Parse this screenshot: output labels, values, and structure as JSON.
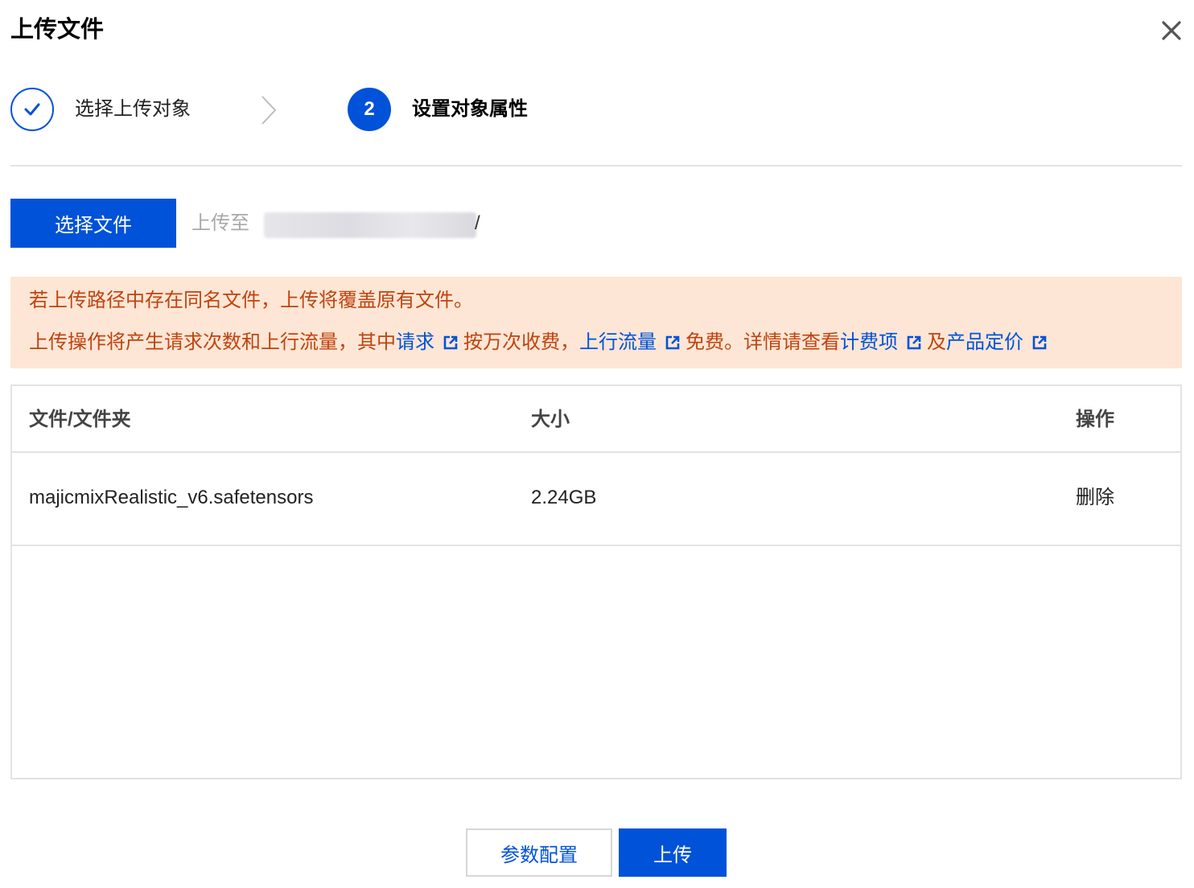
{
  "dialog": {
    "title": "上传文件",
    "close_icon": "close-icon"
  },
  "steps": [
    {
      "label": "选择上传对象",
      "status": "done",
      "icon": "check-icon"
    },
    {
      "number": "2",
      "label": "设置对象属性",
      "status": "active"
    }
  ],
  "toolbar": {
    "select_button": "选择文件",
    "upload_to_label": "上传至",
    "path_suffix": "/"
  },
  "notice": {
    "line1": "若上传路径中存在同名文件，上传将覆盖原有文件。",
    "line2": {
      "p1": "上传操作将产生请求次数和上行流量，其中",
      "link_request": "请求",
      "p2": "按万次收费，",
      "link_traffic": "上行流量",
      "p3": "免费。详情请查看",
      "link_billing": "计费项",
      "p4": "及",
      "link_pricing": "产品定价"
    }
  },
  "table": {
    "headers": {
      "name": "文件/文件夹",
      "size": "大小",
      "operation": "操作"
    },
    "rows": [
      {
        "name": "majicmixRealistic_v6.safetensors",
        "size": "2.24GB",
        "action": "删除"
      }
    ]
  },
  "footer": {
    "params_button": "参数配置",
    "upload_button": "上传"
  },
  "colors": {
    "primary": "#0052d9",
    "notice_bg": "#fde6d5",
    "notice_text": "#c0430f",
    "border": "#e3e3e3"
  }
}
